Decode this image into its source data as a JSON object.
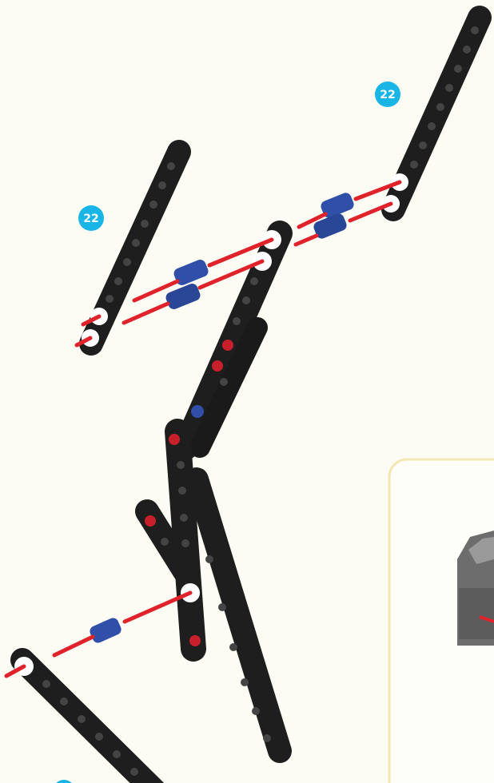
{
  "callouts": {
    "beam_top_right_qty": "22",
    "beam_top_left_qty": "22"
  },
  "colors": {
    "background": "#fcfcf4",
    "beam": "#1e1e1e",
    "stud": "#4a4a4a",
    "axle_line": "#e0222b",
    "connector_pin": "#2f4fa8",
    "red_pin": "#c8202a",
    "callout_badge": "#19b5e6",
    "inset_border": "#f3e7b3"
  },
  "icons": {
    "beam": "studded-beam-icon",
    "connector": "blue-connector-peg-icon",
    "hole": "beam-hole-icon"
  }
}
